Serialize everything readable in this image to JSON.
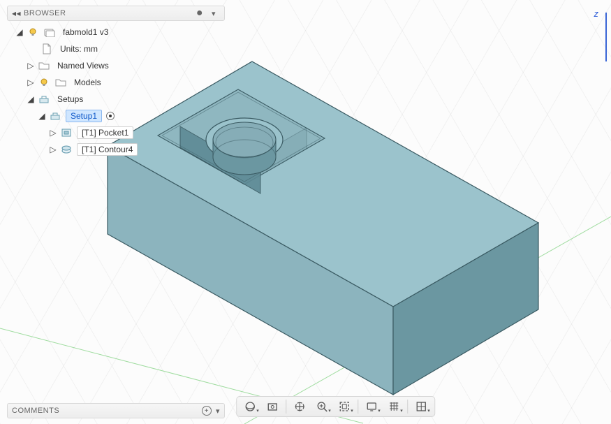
{
  "browser": {
    "header_label": "BROWSER",
    "items": {
      "root": {
        "label": "fabmold1 v3"
      },
      "units": {
        "label": "Units: mm"
      },
      "named_views": {
        "label": "Named Views"
      },
      "models": {
        "label": "Models"
      },
      "setups": {
        "label": "Setups"
      },
      "setup1": {
        "label": "Setup1"
      },
      "pocket1": {
        "label": "[T1] Pocket1"
      },
      "contour4": {
        "label": "[T1] Contour4"
      }
    }
  },
  "comments": {
    "header_label": "COMMENTS"
  },
  "axis": {
    "z_label": "z"
  },
  "nav": {
    "orbit": "Orbit",
    "look": "Look At",
    "pan": "Pan",
    "zoom": "Zoom",
    "fit": "Fit",
    "display": "Display Settings",
    "grid": "Grid and Snaps",
    "viewports": "Viewports"
  },
  "colors": {
    "model_top": "#9BC3CC",
    "model_side_light": "#78A3AD",
    "model_side_dark": "#6B97A1",
    "model_edge": "#3A5A62"
  }
}
